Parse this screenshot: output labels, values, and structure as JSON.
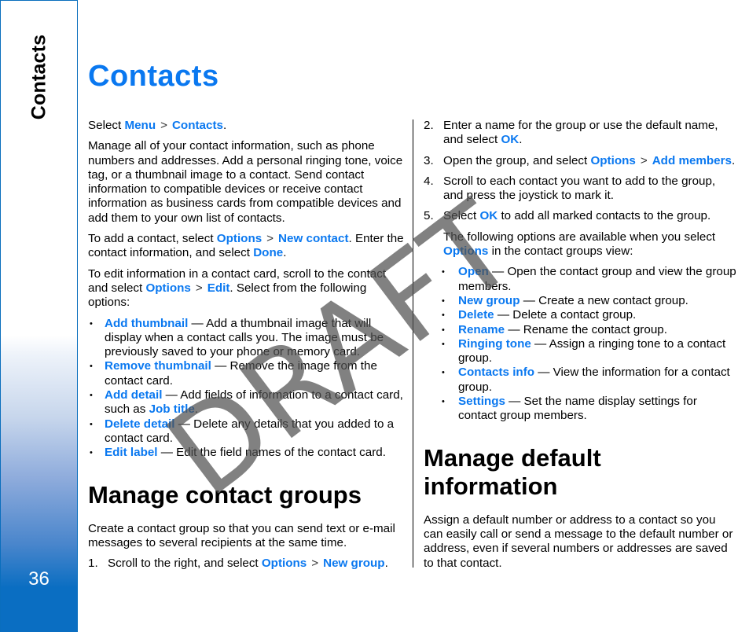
{
  "sidebar": {
    "chapter_label": "Contacts",
    "page_number": "36",
    "accent_color": "#0a6ec2"
  },
  "page": {
    "title": "Contacts",
    "link_color": "#0a78f0",
    "watermark": "DRAFT"
  },
  "left": {
    "intro": {
      "prefix": "Select ",
      "link1": "Menu",
      "sep": ">",
      "link2": "Contacts",
      "suffix": "."
    },
    "para1": "Manage all of your contact information, such as phone numbers and addresses. Add a personal ringing tone, voice tag, or a thumbnail image to a contact. Send contact information to compatible devices or receive contact information as business cards from compatible devices and add them to your own list of contacts.",
    "para2": {
      "prefix": "To add a contact, select ",
      "link1": "Options",
      "sep": ">",
      "link2": "New contact",
      "middle": ". Enter the contact information, and select ",
      "link3": "Done",
      "suffix": "."
    },
    "para3": {
      "prefix": "To edit information in a contact card, scroll to the contact and select ",
      "link1": "Options",
      "sep": ">",
      "link2": "Edit",
      "suffix": ". Select from the following options:"
    },
    "edit_options": [
      {
        "label": "Add thumbnail",
        "text": " — Add a thumbnail image that will display when a contact calls you. The image must be previously saved to your phone or memory card."
      },
      {
        "label": "Remove thumbnail",
        "text": " — Remove the image from the contact card."
      },
      {
        "label": "Add detail",
        "text": " — Add fields of information to a contact card, such as ",
        "link": "Job title",
        "suffix": "."
      },
      {
        "label": "Delete detail",
        "text": " — Delete any details that you added to a contact card."
      },
      {
        "label": "Edit label",
        "text": " — Edit the field names of the contact card."
      }
    ],
    "section_groups": {
      "heading": "Manage contact groups",
      "intro": "Create a contact group so that you can send text or e-mail messages to several recipients at the same time.",
      "step1": {
        "num": "1.",
        "prefix": "Scroll to the right, and select ",
        "link1": "Options",
        "sep": ">",
        "link2": "New group",
        "suffix": "."
      }
    }
  },
  "right": {
    "step2": {
      "num": "2.",
      "prefix": "Enter a name for the group or use the default name, and select ",
      "link": "OK",
      "suffix": "."
    },
    "step3": {
      "num": "3.",
      "prefix": "Open the group, and select ",
      "link1": "Options",
      "sep": ">",
      "link2": "Add members",
      "suffix": "."
    },
    "step4": {
      "num": "4.",
      "text": "Scroll to each contact you want to add to the group, and press the joystick to mark it."
    },
    "step5": {
      "num": "5.",
      "prefix": "Select ",
      "link": "OK",
      "suffix": " to add all marked contacts to the group."
    },
    "options_intro": {
      "prefix": "The following options are available when you select ",
      "link": "Options",
      "suffix": " in the contact groups view:"
    },
    "group_options": [
      {
        "label": "Open",
        "text": " — Open the contact group and view the group members."
      },
      {
        "label": "New group",
        "text": " — Create a new contact group."
      },
      {
        "label": "Delete",
        "text": " — Delete a contact group."
      },
      {
        "label": "Rename",
        "text": " — Rename the contact group."
      },
      {
        "label": "Ringing tone",
        "text": " — Assign a ringing tone to a contact group."
      },
      {
        "label": "Contacts info",
        "text": " — View the information for a contact group."
      },
      {
        "label": "Settings",
        "text": " — Set the name display settings for contact group members."
      }
    ],
    "section_default": {
      "heading": "Manage default information",
      "text": "Assign a default number or address to a contact so you can easily call or send a message to the default number or address, even if several numbers or addresses are saved to that contact."
    }
  }
}
